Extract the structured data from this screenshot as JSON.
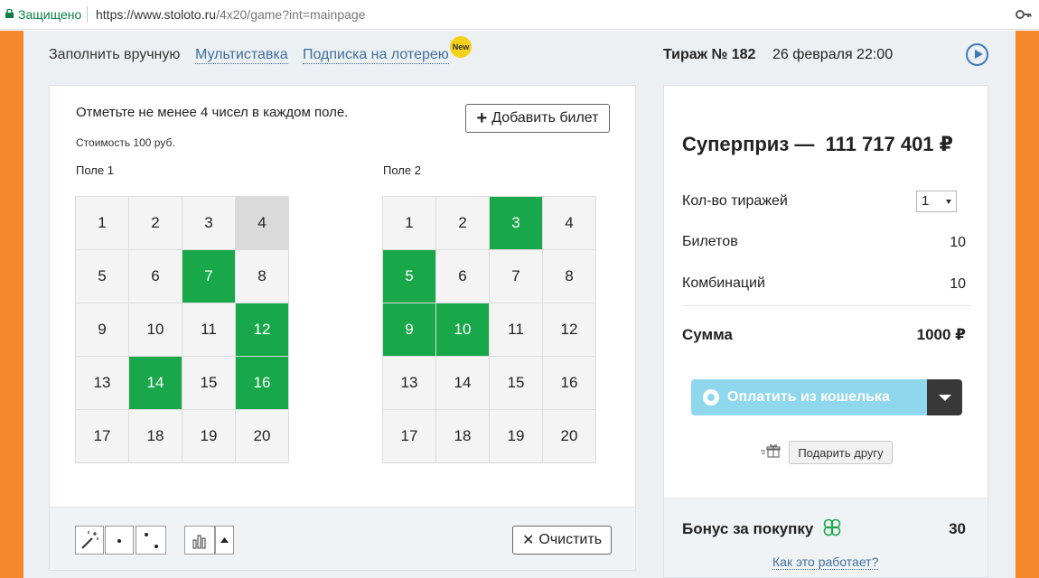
{
  "browser": {
    "secure_label": "Защищено",
    "url_base": "https://www.stoloto.ru",
    "url_path": "/4x20/game?int=mainpage"
  },
  "nav": {
    "manual": "Заполнить вручную",
    "multibet": "Мультиставка",
    "subscription": "Подписка на лотерею",
    "new_badge": "New",
    "draw_label": "Тираж № 182",
    "draw_date": "26 февраля 22:00"
  },
  "ticket": {
    "instruction": "Отметьте не менее 4 чисел в каждом поле.",
    "cost": "Стоимость 100 руб.",
    "add_button": "Добавить билет",
    "fields": [
      {
        "label": "Поле 1",
        "numbers": [
          "1",
          "2",
          "3",
          "4",
          "5",
          "6",
          "7",
          "8",
          "9",
          "10",
          "11",
          "12",
          "13",
          "14",
          "15",
          "16",
          "17",
          "18",
          "19",
          "20"
        ],
        "selected": [
          "7",
          "12",
          "14",
          "16"
        ],
        "hovered": [
          "4"
        ]
      },
      {
        "label": "Поле 2",
        "numbers": [
          "1",
          "2",
          "3",
          "4",
          "5",
          "6",
          "7",
          "8",
          "9",
          "10",
          "11",
          "12",
          "13",
          "14",
          "15",
          "16",
          "17",
          "18",
          "19",
          "20"
        ],
        "selected": [
          "3",
          "5",
          "9",
          "10"
        ],
        "hovered": []
      }
    ],
    "clear_button": "Очистить"
  },
  "summary": {
    "prize_label": "Суперприз —",
    "prize_value": "111 717 401 ₽",
    "draws_label": "Кол-во тиражей",
    "draws_value": "1",
    "tickets_label": "Билетов",
    "tickets_value": "10",
    "combos_label": "Комбинаций",
    "combos_value": "10",
    "sum_label": "Сумма",
    "sum_value": "1000 ₽",
    "pay_button": "Оплатить из кошелька",
    "gift_button": "Подарить другу",
    "bonus_label": "Бонус за покупку",
    "bonus_value": "30",
    "how_link": "Как это работает?"
  },
  "colors": {
    "accent_orange": "#f5882d",
    "selected_green": "#18a84a",
    "link_blue": "#3f6f9e",
    "pay_button": "#8fd7ec"
  }
}
